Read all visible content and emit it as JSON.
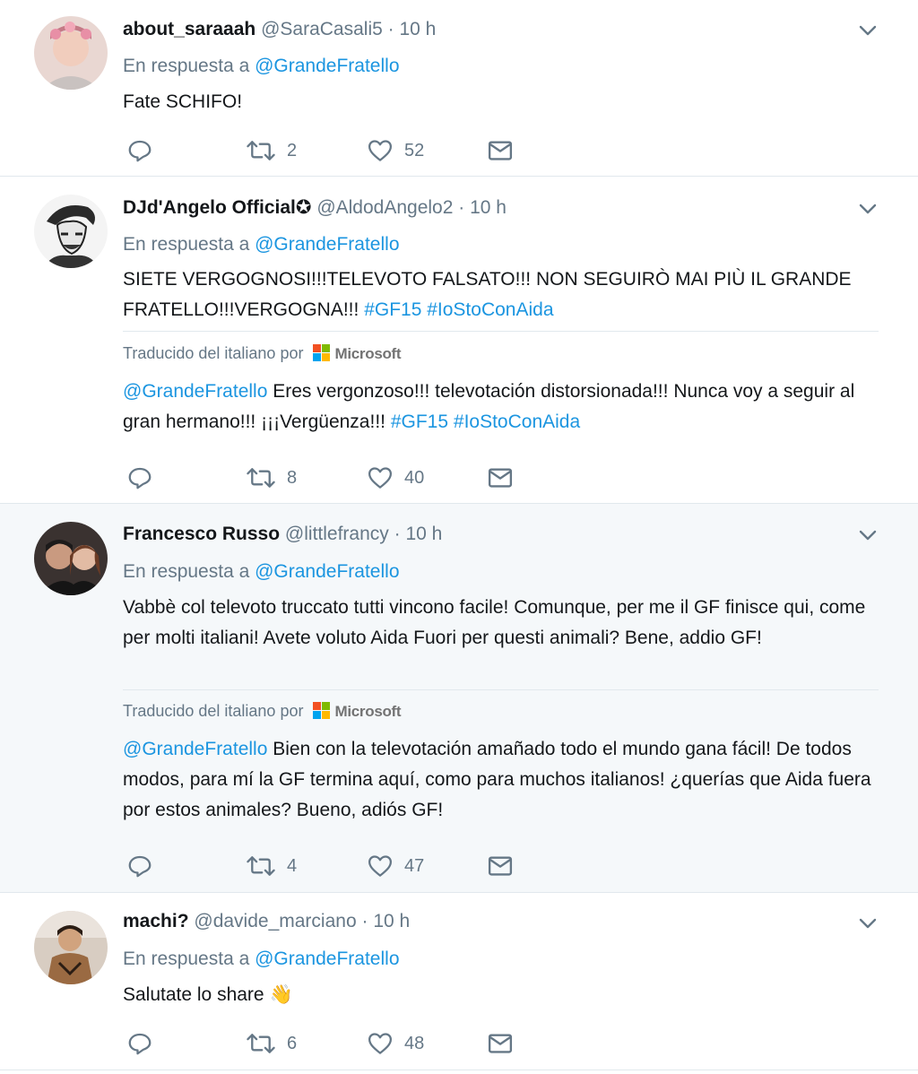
{
  "colors": {
    "link": "#1b95e0",
    "muted": "#657786",
    "text": "#14171a",
    "highlight_bg": "#f5f8fa"
  },
  "tweets": [
    {
      "name": "about_saraaah",
      "handle": "@SaraCasali5",
      "sep": "·",
      "time": "10 h",
      "reply_prefix": "En respuesta a",
      "reply_to": "@GrandeFratello",
      "text": "Fate SCHIFO!",
      "retweets": "2",
      "likes": "52"
    },
    {
      "name": "DJd'Angelo Official",
      "verified_glyph": "✪",
      "handle": "@AldodAngelo2",
      "sep": "·",
      "time": "10 h",
      "reply_prefix": "En respuesta a",
      "reply_to": "@GrandeFratello",
      "text": "SIETE VERGOGNOSI!!!TELEVOTO FALSATO!!! NON SEGUIRÒ MAI PIÙ IL GRANDE FRATELLO!!!VERGOGNA!!!",
      "hashtag1": "#GF15",
      "hashtag2": "#IoStoConAida",
      "translation_label": "Traducido del italiano por",
      "translation_brand": "Microsoft",
      "translation_mention": "@GrandeFratello",
      "translation_text": "Eres vergonzoso!!! televotación distorsionada!!! Nunca voy a seguir al gran hermano!!! ¡¡¡Vergüenza!!!",
      "translation_hashtag1": "#GF15",
      "translation_hashtag2": "#IoStoConAida",
      "retweets": "8",
      "likes": "40"
    },
    {
      "name": "Francesco Russo",
      "handle": "@littlefrancy",
      "sep": "·",
      "time": "10 h",
      "reply_prefix": "En respuesta a",
      "reply_to": "@GrandeFratello",
      "text": "Vabbè col televoto truccato tutti vincono facile! Comunque, per me il GF finisce qui, come per molti italiani! Avete voluto Aida Fuori per questi animali? Bene, addio GF!",
      "translation_label": "Traducido del italiano por",
      "translation_brand": "Microsoft",
      "translation_mention": "@GrandeFratello",
      "translation_text": "Bien con la televotación amañado todo el mundo gana fácil! De todos modos, para mí la GF termina aquí, como para muchos italianos! ¿querías que Aida fuera por estos animales? Bueno, adiós GF!",
      "retweets": "4",
      "likes": "47"
    },
    {
      "name": "machi?",
      "handle": "@davide_marciano",
      "sep": "·",
      "time": "10 h",
      "reply_prefix": "En respuesta a",
      "reply_to": "@GrandeFratello",
      "text": "Salutate lo share",
      "emoji": "👋",
      "retweets": "6",
      "likes": "48"
    }
  ]
}
